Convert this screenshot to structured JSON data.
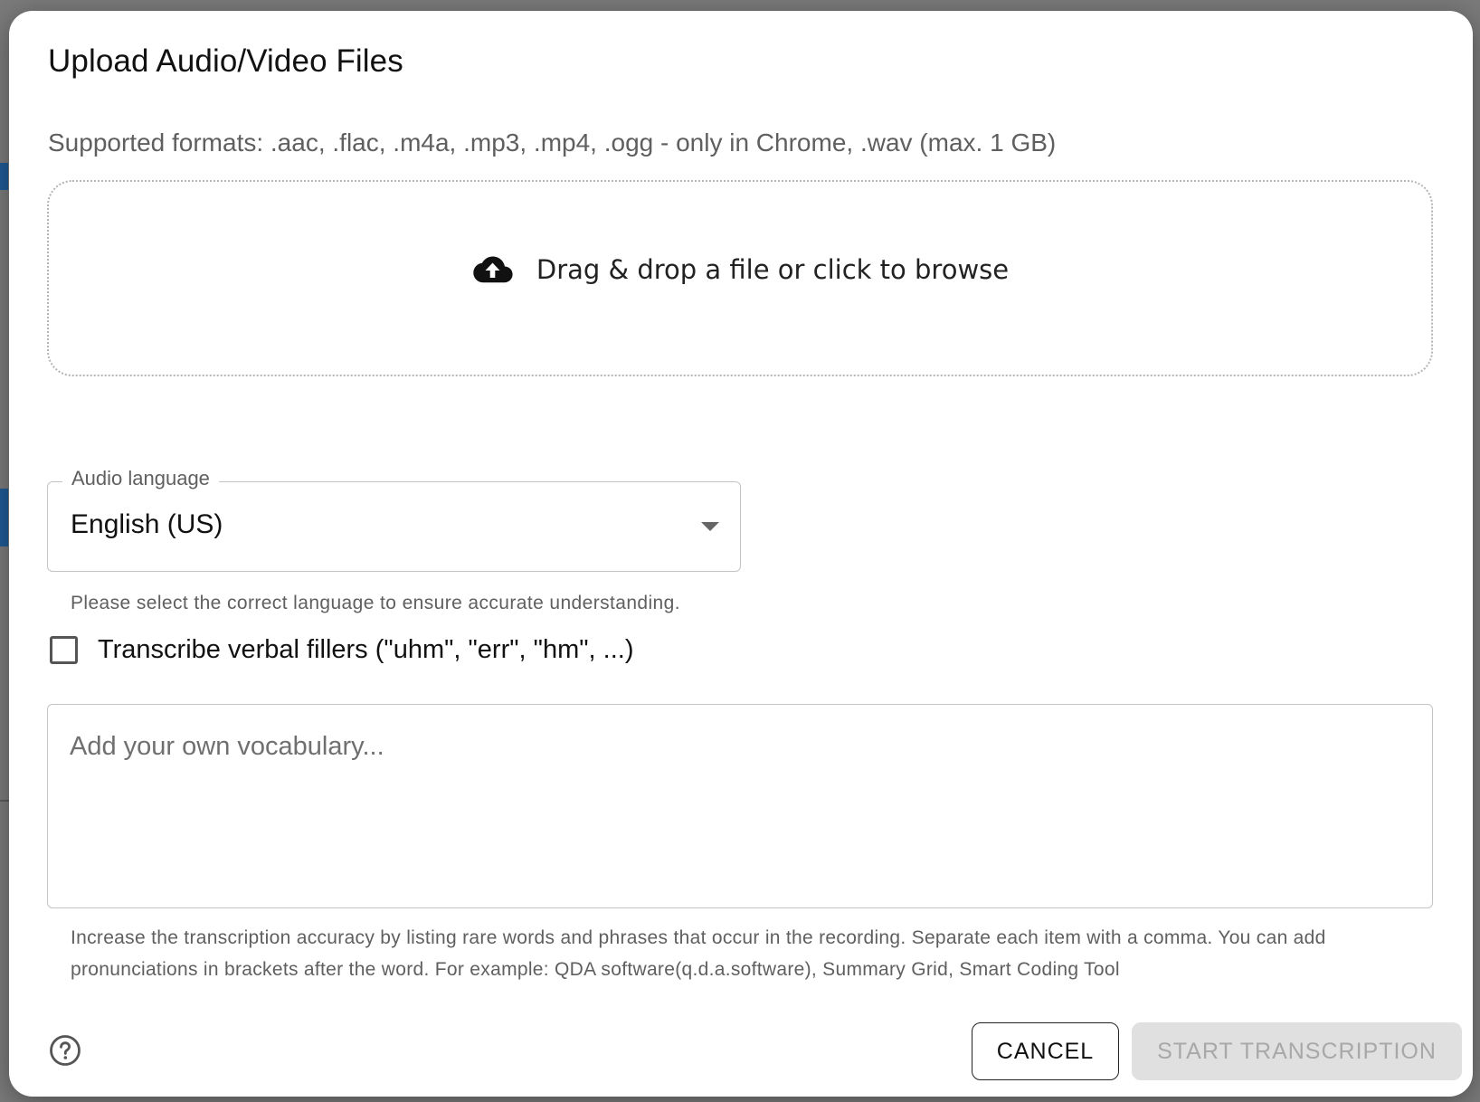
{
  "modal": {
    "title": "Upload Audio/Video Files",
    "supported_formats": "Supported formats: .aac, .flac, .m4a, .mp3, .mp4, .ogg - only in Chrome, .wav (max. 1 GB)"
  },
  "dropzone": {
    "icon": "cloud-upload-icon",
    "label": "Drag & drop a file or click to browse"
  },
  "language_select": {
    "label": "Audio language",
    "value": "English (US)",
    "helper": "Please select the correct language to ensure accurate understanding."
  },
  "fillers_checkbox": {
    "label": "Transcribe verbal fillers (\"uhm\", \"err\", \"hm\", ...)",
    "checked": false
  },
  "vocabulary": {
    "value": "",
    "placeholder": "Add your own vocabulary...",
    "helper": "Increase the transcription accuracy by listing rare words and phrases that occur in the recording. Separate each item with a comma. You can add pronunciations in brackets after the word. For example: QDA software(q.d.a.software), Summary Grid, Smart Coding Tool"
  },
  "footer": {
    "help_icon": "help-circle-icon",
    "cancel_label": "CANCEL",
    "start_label": "START TRANSCRIPTION"
  },
  "colors": {
    "overlay": "#7a7a7a",
    "background_accent": "#1f5a96",
    "disabled_button_bg": "#e0e0e0",
    "disabled_button_text": "#a8a8a8"
  }
}
